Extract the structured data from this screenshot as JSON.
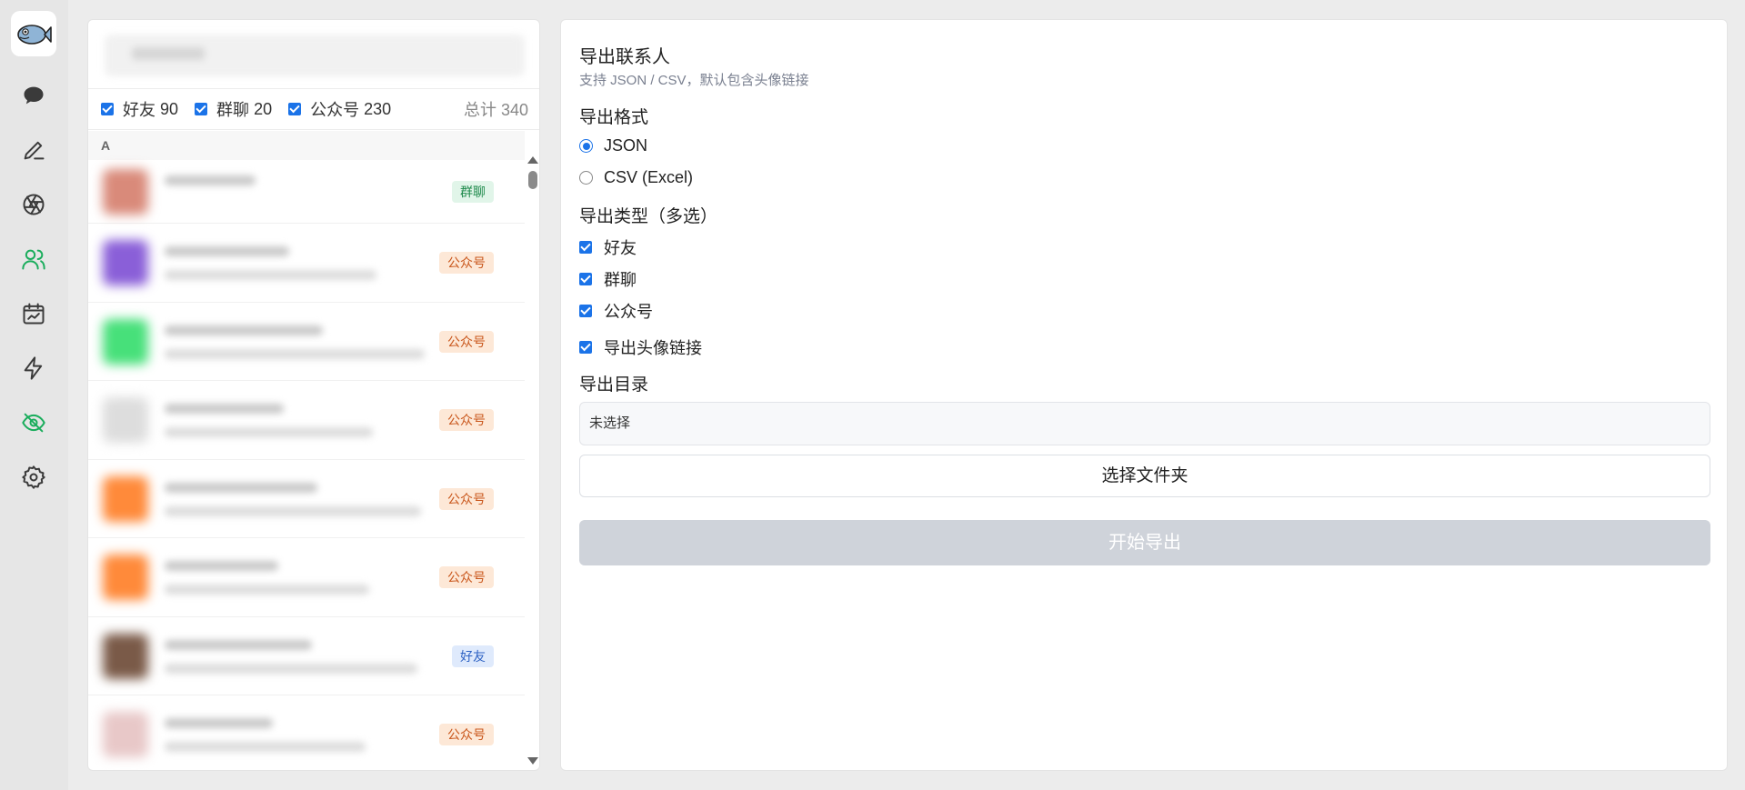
{
  "sidebar": {
    "logo_icon": "fish-logo-icon",
    "items": [
      {
        "name": "chat",
        "icon": "chat-bubble-icon",
        "active": false
      },
      {
        "name": "edit",
        "icon": "pen-icon",
        "active": false
      },
      {
        "name": "moments",
        "icon": "aperture-icon",
        "active": false
      },
      {
        "name": "contacts",
        "icon": "contacts-icon",
        "active": true
      },
      {
        "name": "calendar",
        "icon": "calendar-chart-icon",
        "active": false
      },
      {
        "name": "automation",
        "icon": "lightning-icon",
        "active": false
      },
      {
        "name": "privacy",
        "icon": "eye-off-icon",
        "active": true
      },
      {
        "name": "settings",
        "icon": "gear-icon",
        "active": false
      }
    ],
    "accent": "#1aad5c"
  },
  "contact_list": {
    "filters": [
      {
        "label": "好友",
        "count": "90",
        "checked": true
      },
      {
        "label": "群聊",
        "count": "20",
        "checked": true
      },
      {
        "label": "公众号",
        "count": "230",
        "checked": true
      }
    ],
    "total_label": "总计 340",
    "group_letter": "A",
    "rows": [
      {
        "tag": "群聊",
        "type": "group",
        "avatar_color": "#d98a7a"
      },
      {
        "tag": "公众号",
        "type": "official",
        "avatar_color": "#8a5fd8"
      },
      {
        "tag": "公众号",
        "type": "official",
        "avatar_color": "#47e07a"
      },
      {
        "tag": "公众号",
        "type": "official",
        "avatar_color": "#dddddd"
      },
      {
        "tag": "公众号",
        "type": "official",
        "avatar_color": "#ff8a3a"
      },
      {
        "tag": "公众号",
        "type": "official",
        "avatar_color": "#ff8a3a"
      },
      {
        "tag": "好友",
        "type": "friend",
        "avatar_color": "#7a5a48"
      },
      {
        "tag": "公众号",
        "type": "official",
        "avatar_color": "#e8c8c8"
      }
    ]
  },
  "export_panel": {
    "title": "导出联系人",
    "subtitle": "支持 JSON / CSV，默认包含头像链接",
    "format_label": "导出格式",
    "formats": [
      {
        "label": "JSON",
        "selected": true
      },
      {
        "label": "CSV (Excel)",
        "selected": false
      }
    ],
    "types_label": "导出类型（多选）",
    "types": [
      {
        "label": "好友",
        "checked": true
      },
      {
        "label": "群聊",
        "checked": true
      },
      {
        "label": "公众号",
        "checked": true
      }
    ],
    "avatar_option": {
      "label": "导出头像链接",
      "checked": true
    },
    "dir_label": "导出目录",
    "dir_value": "未选择",
    "choose_button": "选择文件夹",
    "start_button": "开始导出"
  }
}
